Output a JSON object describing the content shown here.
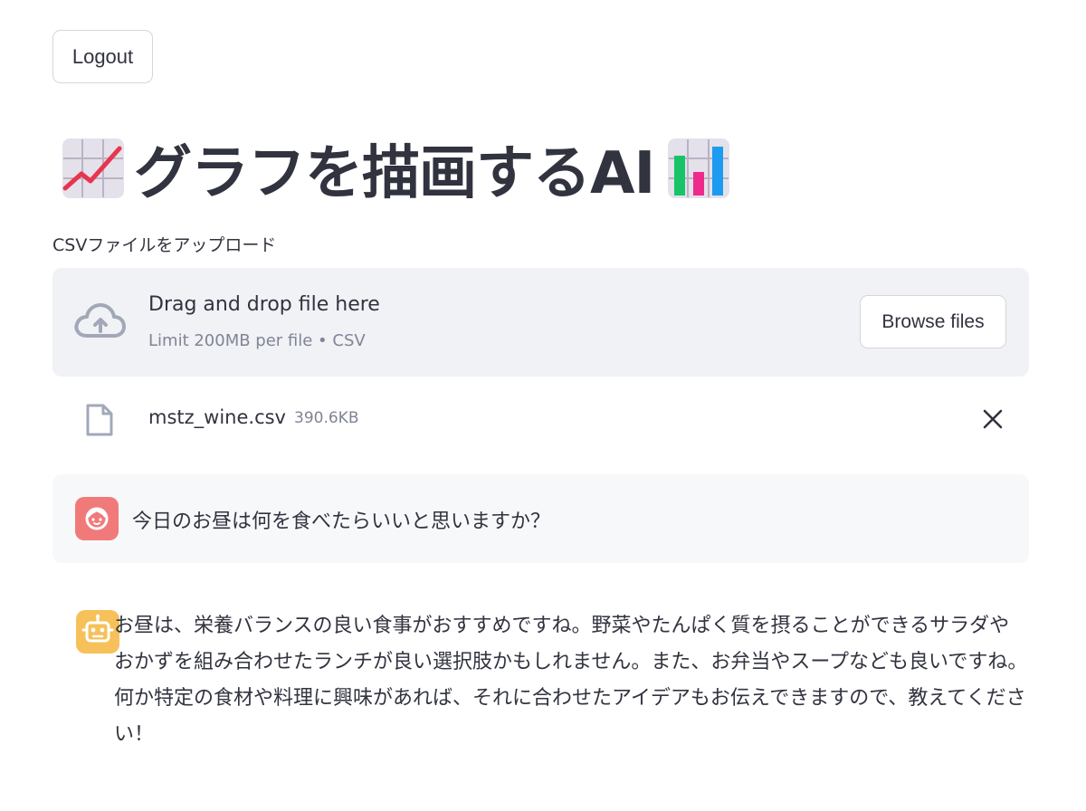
{
  "logout_label": "Logout",
  "title": {
    "text": "グラフを描画するAI",
    "left_emoji": "chart-increasing-icon",
    "right_emoji": "bar-chart-icon"
  },
  "uploader": {
    "label": "CSVファイルをアップロード",
    "drop_text": "Drag and drop file here",
    "limit_text": "Limit 200MB per file • CSV",
    "browse_label": "Browse files",
    "icon": "cloud-upload-icon"
  },
  "uploaded_file": {
    "name": "mstz_wine.csv",
    "size": "390.6KB",
    "icon": "file-icon",
    "remove_icon": "close-icon"
  },
  "chat": {
    "user_message": "今日のお昼は何を食べたらいいと思いますか？",
    "assistant_message": "お昼は、栄養バランスの良い食事がおすすめですね。野菜やたんぱく質を摂ることができるサラダやおかずを組み合わせたランチが良い選択肢かもしれません。また、お弁当やスープなども良いですね。何か特定の食材や料理に興味があれば、それに合わせたアイデアもお伝えできますので、教えてください！",
    "user_avatar_color": "#f07a7a",
    "assistant_avatar_color": "#f6c15a"
  },
  "colors": {
    "text": "#31333f",
    "muted": "#808495",
    "dropzone_bg": "#f0f2f6",
    "user_msg_bg": "#f7f8fa"
  }
}
